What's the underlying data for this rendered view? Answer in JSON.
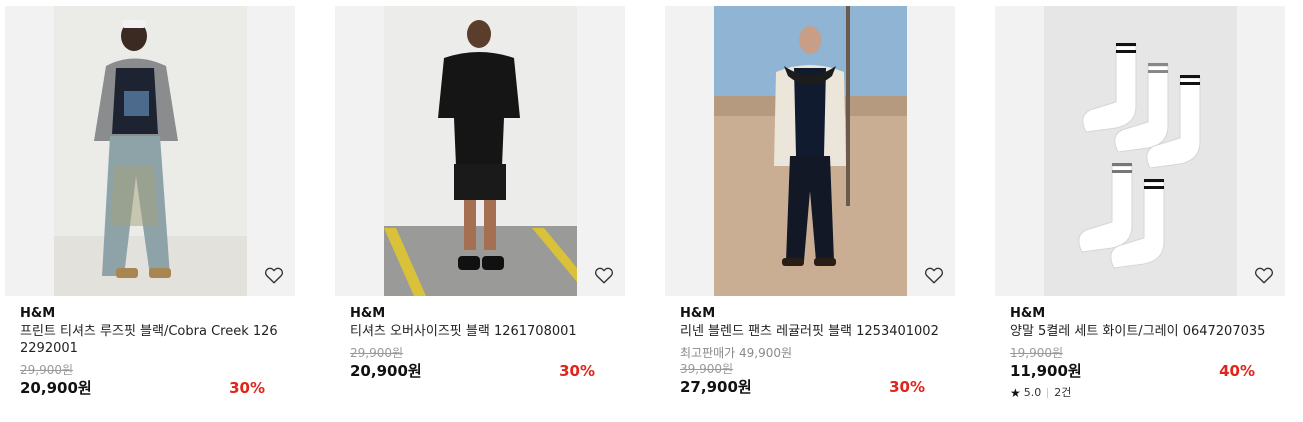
{
  "products": [
    {
      "brand": "H&M",
      "name": "프린트 티셔츠 루즈핏 블랙/Cobra Creek 1262292001",
      "note": "",
      "original_price": "29,900원",
      "price": "20,900원",
      "discount": "30%",
      "rating": "",
      "reviews": "",
      "heart_icon": "heart-outline-icon"
    },
    {
      "brand": "H&M",
      "name": "티셔츠 오버사이즈핏 블랙 1261708001",
      "note": "",
      "original_price": "29,900원",
      "price": "20,900원",
      "discount": "30%",
      "rating": "",
      "reviews": "",
      "heart_icon": "heart-outline-icon"
    },
    {
      "brand": "H&M",
      "name": "리넨 블렌드 팬츠 레귤러핏 블랙 1253401002",
      "note": "최고판매가 49,900원",
      "original_price": "39,900원",
      "price": "27,900원",
      "discount": "30%",
      "rating": "",
      "reviews": "",
      "heart_icon": "heart-outline-icon"
    },
    {
      "brand": "H&M",
      "name": "양말 5켤레 세트 화이트/그레이 0647207035",
      "note": "",
      "original_price": "19,900원",
      "price": "11,900원",
      "discount": "40%",
      "rating": "5.0",
      "reviews": "2건",
      "heart_icon": "heart-outline-icon"
    }
  ],
  "colors": {
    "discount": "#e0251b",
    "thumb_bg": "#f2f2f2"
  }
}
